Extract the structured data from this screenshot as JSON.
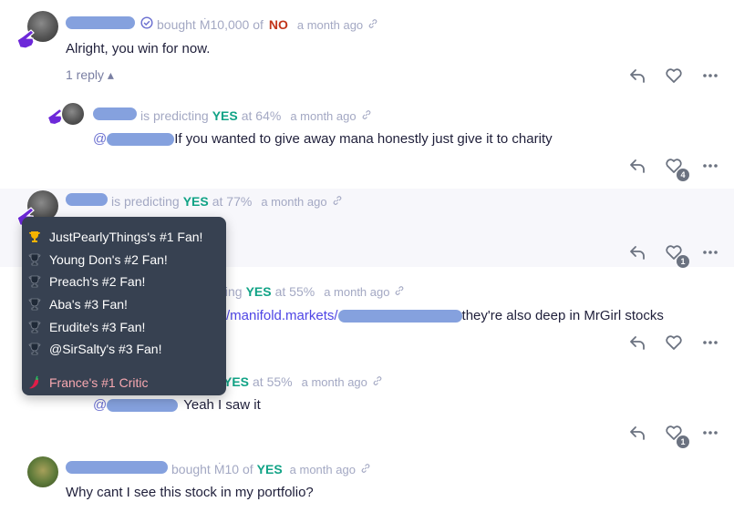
{
  "comments": [
    {
      "verb": "bought",
      "amount": "Ṁ10,000 of",
      "outcome": "NO",
      "time": "a month ago",
      "text": "Alright, you win for now.",
      "replies_label": "1 reply ▴"
    },
    {
      "verb": "is predicting",
      "outcome": "YES",
      "prob": "at 64%",
      "time": "a month ago",
      "mention": "@",
      "text": "If you wanted to give away mana honestly just give it to charity",
      "likes": "4"
    },
    {
      "verb": "is predicting",
      "outcome": "YES",
      "prob": "at 77%",
      "time": "a month ago",
      "likes": "1"
    },
    {
      "verb": "ting",
      "outcome": "YES",
      "prob": "at 55%",
      "time": "a month ago",
      "url": "/manifold.markets/",
      "text": "they're also deep in MrGirl stocks"
    },
    {
      "outcome": "YES",
      "prob": "at 55%",
      "time": "a month ago",
      "mention": "@",
      "text": "Yeah I saw it",
      "likes": "1"
    },
    {
      "verb": "bought",
      "amount": "Ṁ10 of",
      "outcome": "YES",
      "time": "a month ago",
      "text": "Why cant I see this stock in my portfolio?"
    }
  ],
  "popover": {
    "items": [
      {
        "label": "JustPearlyThings's #1 Fan!",
        "icon": "gold-trophy-icon"
      },
      {
        "label": "Young Don's #2 Fan!",
        "icon": "trophy-icon"
      },
      {
        "label": "Preach's #2 Fan!",
        "icon": "trophy-icon"
      },
      {
        "label": "Aba's #3 Fan!",
        "icon": "trophy-icon"
      },
      {
        "label": "Erudite's #3 Fan!",
        "icon": "trophy-icon"
      },
      {
        "label": "@SirSalty's #3 Fan!",
        "icon": "trophy-icon"
      }
    ],
    "critic": {
      "label": "France's #1 Critic",
      "icon": "chili-pepper-icon"
    }
  },
  "colors": {
    "yes": "#11a386",
    "no": "#c2361b",
    "popover_bg": "#374151",
    "hand": "#6d28d9"
  }
}
